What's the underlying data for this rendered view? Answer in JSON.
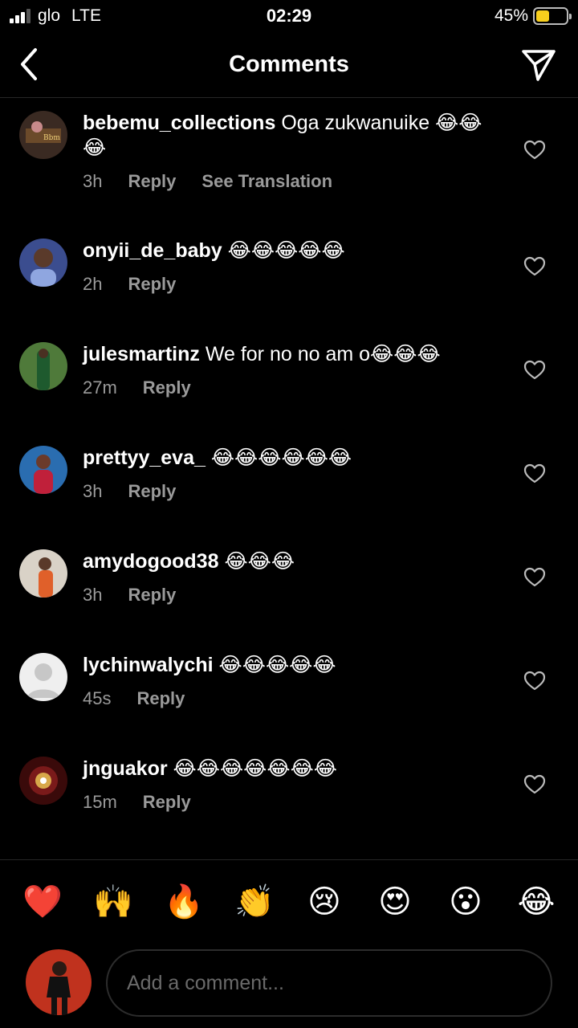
{
  "status_bar": {
    "carrier": "glo",
    "network": "LTE",
    "time": "02:29",
    "battery_percent": "45%",
    "battery_level": 0.45,
    "signal_bars": 3
  },
  "header": {
    "title": "Comments",
    "back_icon": "chevron-left-icon",
    "send_icon": "paper-plane-icon"
  },
  "comments": [
    {
      "username": "bebemu_collections",
      "text": "Oga zukwanuike 😂😂😂",
      "time": "3h",
      "reply": "Reply",
      "translate": "See Translation"
    },
    {
      "username": "onyii_de_baby",
      "text": "😂😂😂😂😂",
      "time": "2h",
      "reply": "Reply"
    },
    {
      "username": "julesmartinz",
      "text": "We for no no am o😂😂😂",
      "time": "27m",
      "reply": "Reply"
    },
    {
      "username": "prettyy_eva_",
      "text": "😂😂😂😂😂😂",
      "time": "3h",
      "reply": "Reply"
    },
    {
      "username": "amydogood38",
      "text": "😂😂😂",
      "time": "3h",
      "reply": "Reply"
    },
    {
      "username": "lychinwalychi",
      "text": "😂😂😂😂😂",
      "time": "45s",
      "reply": "Reply"
    },
    {
      "username": "jnguakor",
      "text": "😂😂😂😂😂😂😂",
      "time": "15m",
      "reply": "Reply"
    }
  ],
  "quick_reactions": [
    "❤️",
    "🙌",
    "🔥",
    "👏",
    "😢",
    "😍",
    "😮",
    "😂"
  ],
  "composer": {
    "placeholder": "Add a comment..."
  },
  "colors": {
    "background": "#000000",
    "meta_text": "#9a9a9a",
    "divider": "#262626",
    "battery": "#f7cf1d"
  }
}
